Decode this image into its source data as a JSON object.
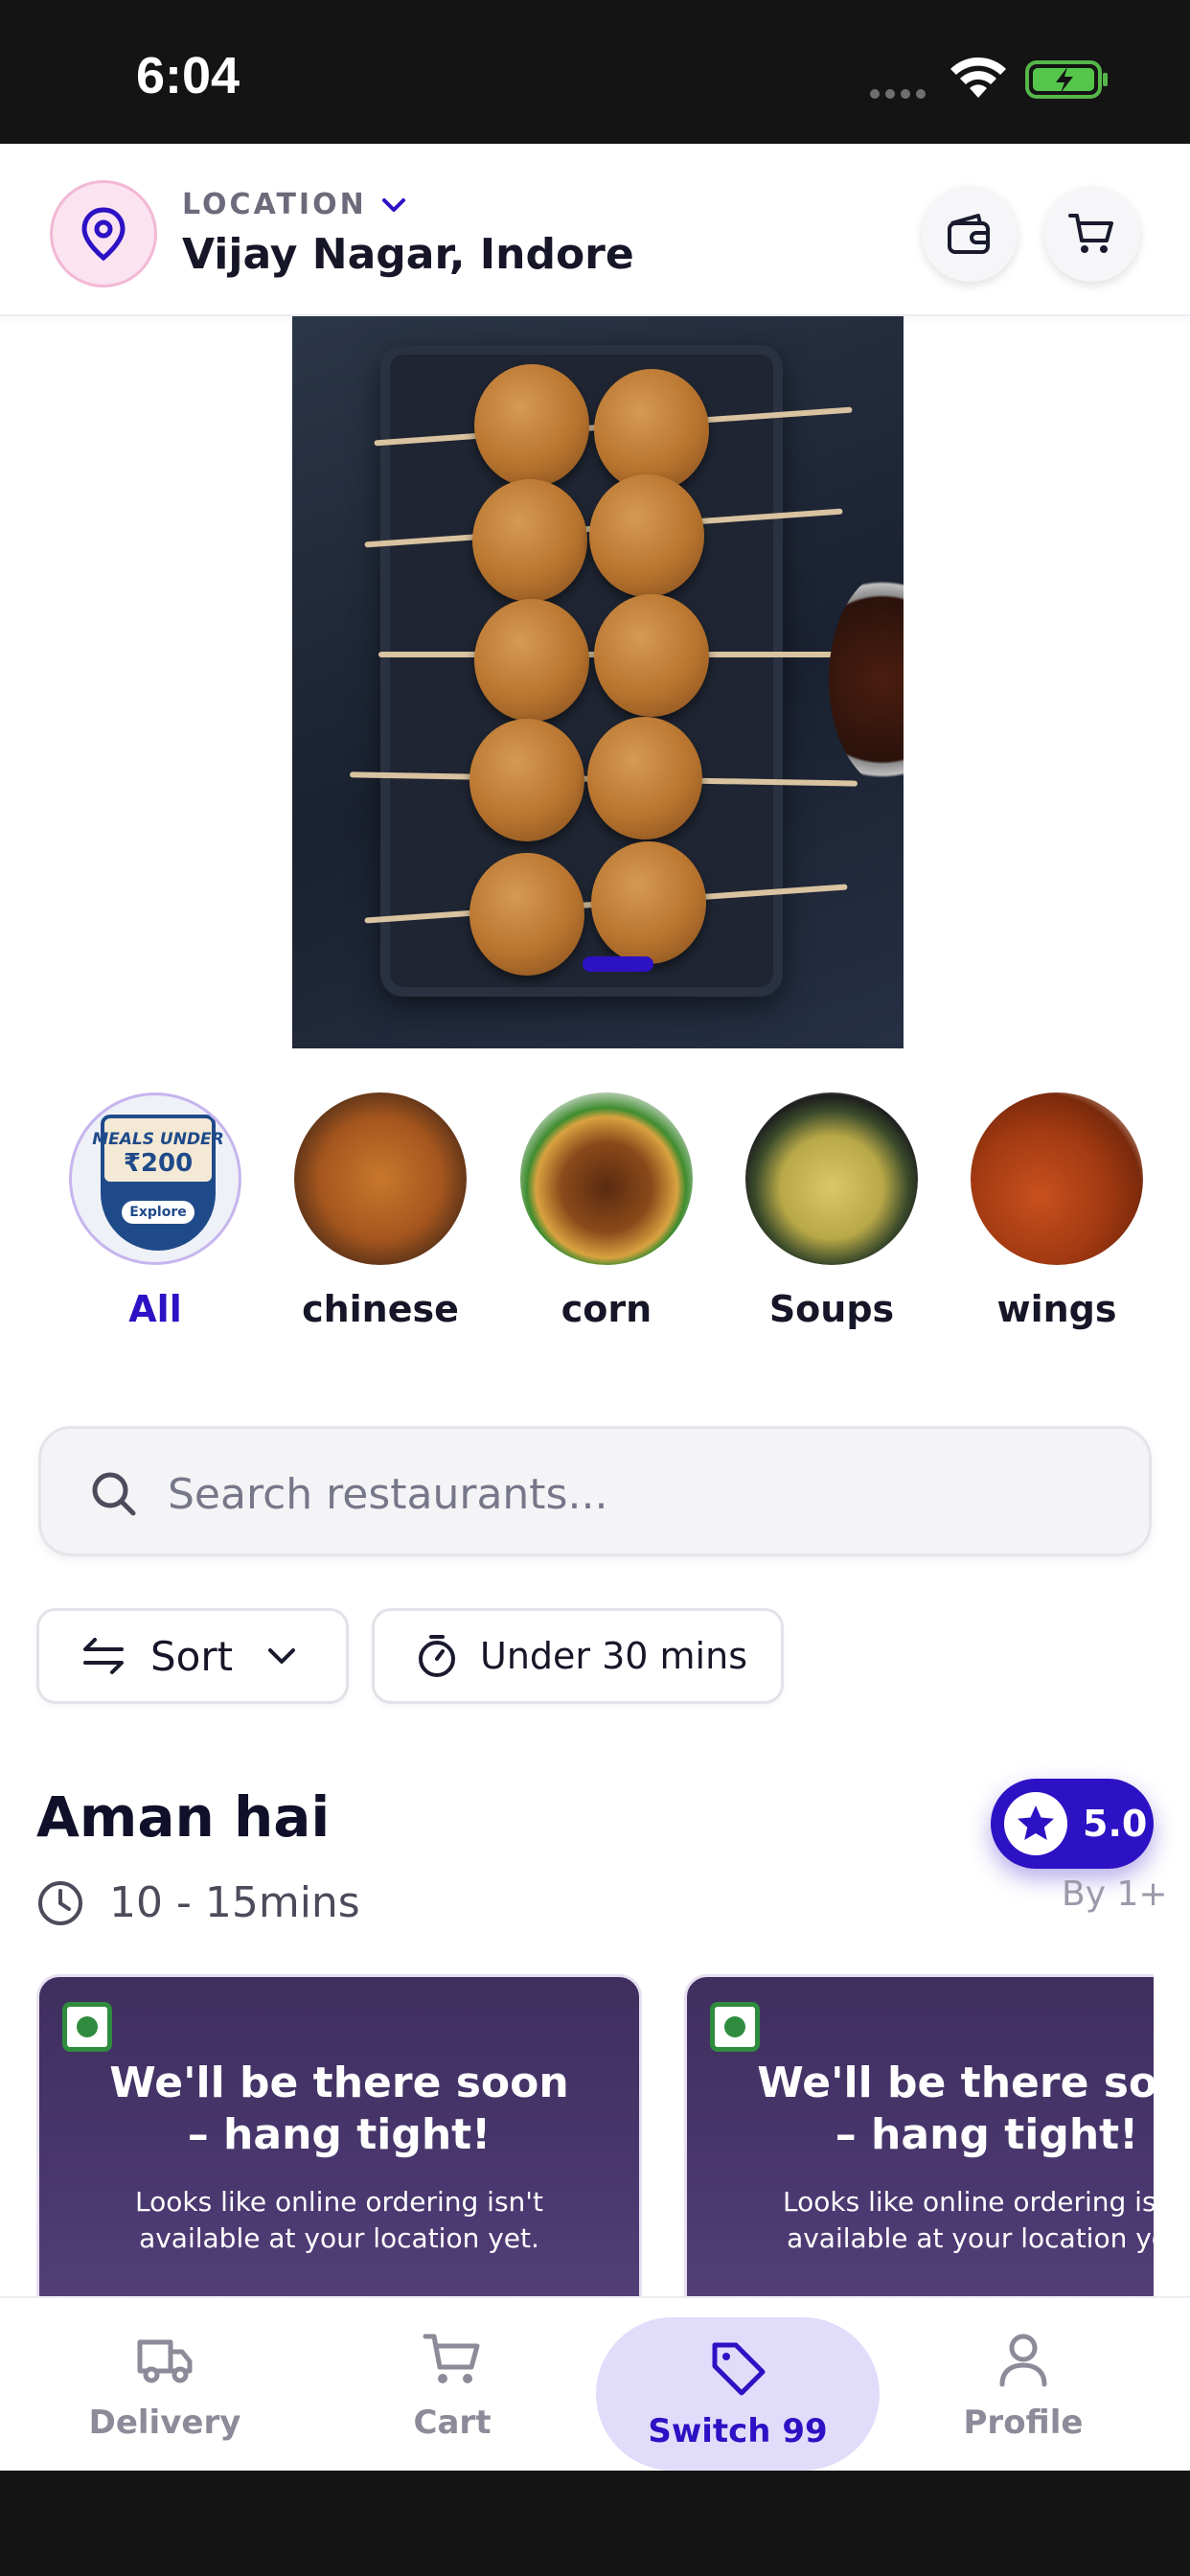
{
  "status_bar": {
    "time": "6:04"
  },
  "header": {
    "location_label": "LOCATION",
    "location_name": "Vijay Nagar, Indore",
    "icons": [
      "location-pin-icon",
      "wallet-icon",
      "cart-icon"
    ]
  },
  "banner": {
    "active_slide": 1
  },
  "categories": [
    {
      "label": "All",
      "image_text_top": "MEALS UNDER",
      "image_text_price": "₹200",
      "image_text_button": "Explore",
      "active": true
    },
    {
      "label": "chinese"
    },
    {
      "label": "corn"
    },
    {
      "label": "Soups"
    },
    {
      "label": "wings"
    }
  ],
  "search": {
    "placeholder": "Search restaurants..."
  },
  "filters": {
    "sort_label": "Sort",
    "time_label": "Under 30 mins"
  },
  "restaurant": {
    "name": "Aman hai",
    "delivery_time": "10 - 15mins",
    "rating": "5.0",
    "rating_by": "By 1+",
    "cards": [
      {
        "title": "We'll be there soon – hang tight!",
        "message": "Looks like online ordering isn't available at your location yet."
      },
      {
        "title": "We'll be there soon – hang tight!",
        "message": "Looks like online ordering isn't available at your location yet."
      }
    ]
  },
  "bottom_nav": {
    "items": [
      {
        "label": "Delivery",
        "icon": "truck-icon"
      },
      {
        "label": "Cart",
        "icon": "cart-icon"
      },
      {
        "label": "Switch 99",
        "icon": "tag-icon",
        "active": true
      },
      {
        "label": "Profile",
        "icon": "user-icon"
      }
    ]
  },
  "colors": {
    "accent": "#2c12c4",
    "accent_light": "#e2dcfb",
    "card_bg": "#4a3870",
    "veg_green": "#2f8c3f"
  }
}
